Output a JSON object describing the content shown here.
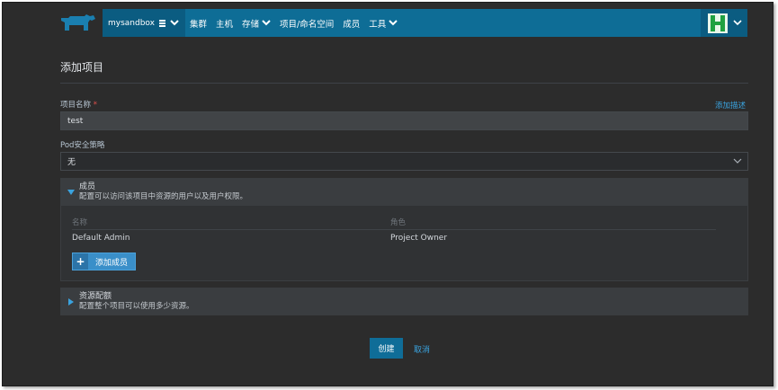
{
  "header": {
    "environment": "mysandbox",
    "nav": [
      {
        "label": "集群",
        "has_dropdown": false
      },
      {
        "label": "主机",
        "has_dropdown": false
      },
      {
        "label": "存储",
        "has_dropdown": true
      },
      {
        "label": "项目/命名空间",
        "has_dropdown": false
      },
      {
        "label": "成员",
        "has_dropdown": false
      },
      {
        "label": "工具",
        "has_dropdown": true
      }
    ],
    "colors": {
      "nav_bg": "#0e6d96",
      "env_bg": "#0b5c81",
      "avatar_green": "#1fa141"
    }
  },
  "page": {
    "title": "添加项目"
  },
  "form": {
    "project_name_label": "项目名称",
    "required_mark": "*",
    "add_description_link": "添加描述",
    "project_name_value": "test",
    "pod_policy_label": "Pod安全策略",
    "pod_policy_value": "无"
  },
  "members": {
    "title": "成员",
    "description": "配置可以访问该项目中资源的用户以及用户权限。",
    "columns": {
      "name": "名称",
      "role": "角色"
    },
    "rows": [
      {
        "name": "Default Admin",
        "role": "Project Owner"
      }
    ],
    "add_button": "添加成员"
  },
  "quota": {
    "title": "资源配额",
    "description": "配置整个项目可以使用多少资源。"
  },
  "actions": {
    "create": "创建",
    "cancel": "取消"
  }
}
